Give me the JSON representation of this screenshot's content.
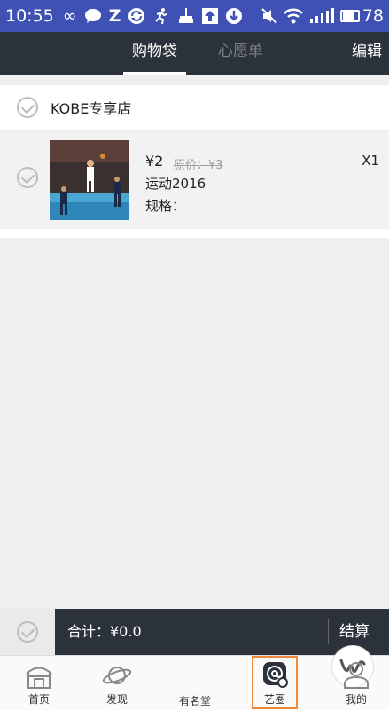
{
  "status_bar": {
    "time": "10:55",
    "battery_level": "78"
  },
  "header": {
    "tab_cart": "购物袋",
    "tab_wishlist": "心愿单",
    "edit_label": "编辑"
  },
  "store": {
    "name": "KOBE专享店"
  },
  "cart_item": {
    "price": "¥2",
    "original_price": "原价：¥3",
    "quantity": "X1",
    "name": "运动2016",
    "spec": "规格："
  },
  "totals": {
    "total_label": "合计：¥0.0",
    "checkout_label": "结算"
  },
  "bottom_nav": {
    "items": [
      {
        "label": "首页"
      },
      {
        "label": "发现"
      },
      {
        "label": "有名堂"
      },
      {
        "label": "艺圈"
      },
      {
        "label": "我的"
      }
    ]
  }
}
